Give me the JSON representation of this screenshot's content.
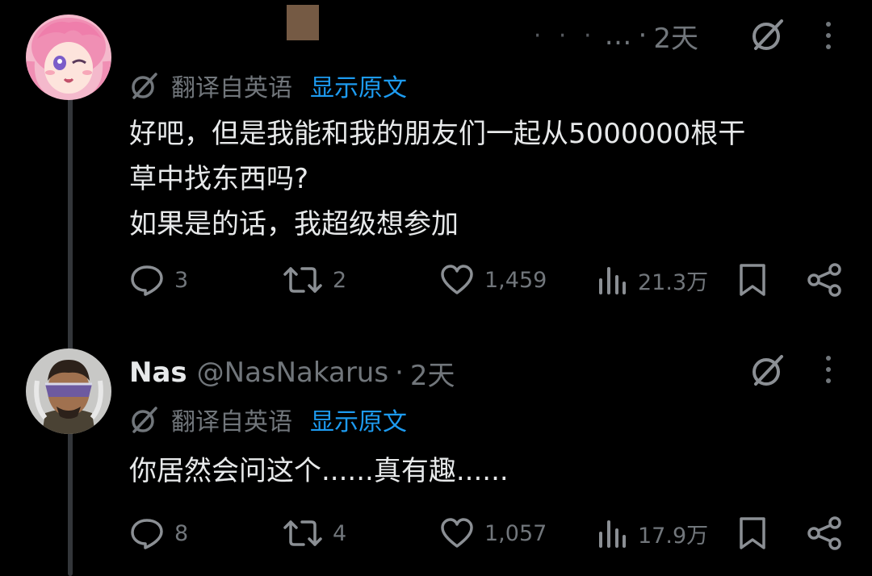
{
  "colors": {
    "background": "#000000",
    "primary_text": "#e7e9ea",
    "secondary_text": "#71767b",
    "link": "#1d9bf0",
    "thread_line": "#33363a"
  },
  "tweets": [
    {
      "display_name": "",
      "handle": "…",
      "time": "2天",
      "translate_label": "翻译自英语",
      "show_original": "显示原文",
      "body_lines": [
        "好吧，但是我能和我的朋友们一起从5000000根干",
        "草中找东西吗?",
        "如果是的话，我超级想参加"
      ],
      "stats": {
        "replies": "3",
        "retweets": "2",
        "likes": "1,459",
        "views": "21.3万"
      }
    },
    {
      "display_name": "Nas",
      "handle": "@NasNakarus",
      "time": "2天",
      "translate_label": "翻译自英语",
      "show_original": "显示原文",
      "body_lines": [
        "你居然会问这个......真有趣......"
      ],
      "stats": {
        "replies": "8",
        "retweets": "4",
        "likes": "1,057",
        "views": "17.9万"
      }
    }
  ],
  "icons": {
    "grok": "grok-icon",
    "more": "more-vertical-icon",
    "reply": "reply-icon",
    "retweet": "retweet-icon",
    "like": "heart-icon",
    "views": "views-icon",
    "bookmark": "bookmark-icon",
    "share": "share-icon",
    "translate": "translate-icon"
  }
}
